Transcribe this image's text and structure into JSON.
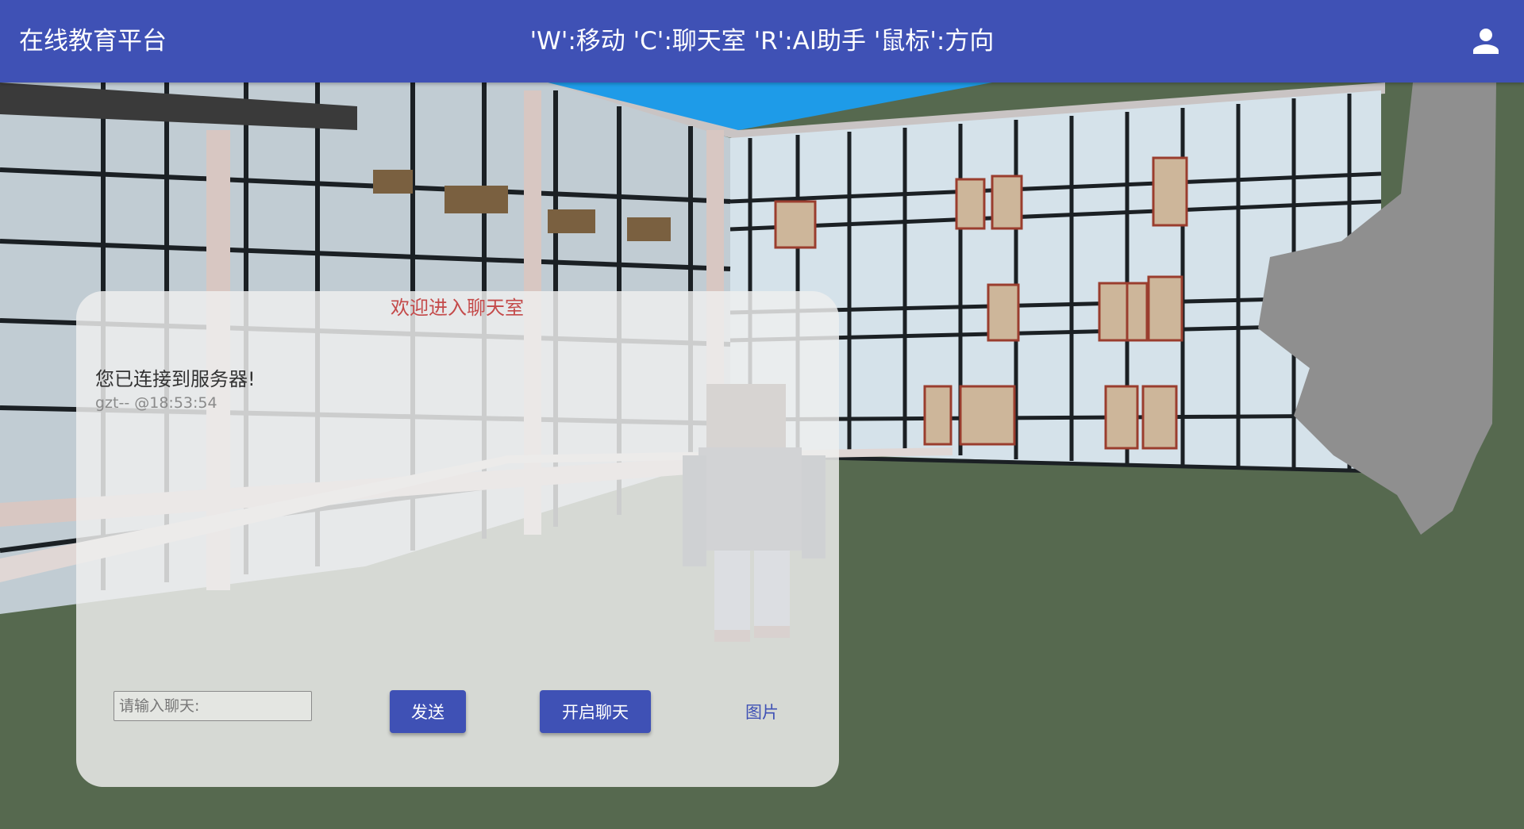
{
  "header": {
    "title": "在线教育平台",
    "hint": "'W':移动 'C':聊天室 'R':AI助手 '鼠标':方向",
    "user_icon": "account-icon"
  },
  "chat": {
    "title": "欢迎进入聊天室",
    "messages": [
      {
        "text": "您已连接到服务器!",
        "meta": "gzt-- @18:53:54"
      }
    ],
    "input_placeholder": "请输入聊天:",
    "send_label": "发送",
    "start_label": "开启聊天",
    "image_label": "图片"
  },
  "colors": {
    "primary": "#3f51b5",
    "chat_title": "#c44a4a",
    "ground": "#56694f",
    "sky": "#1e9be8"
  }
}
